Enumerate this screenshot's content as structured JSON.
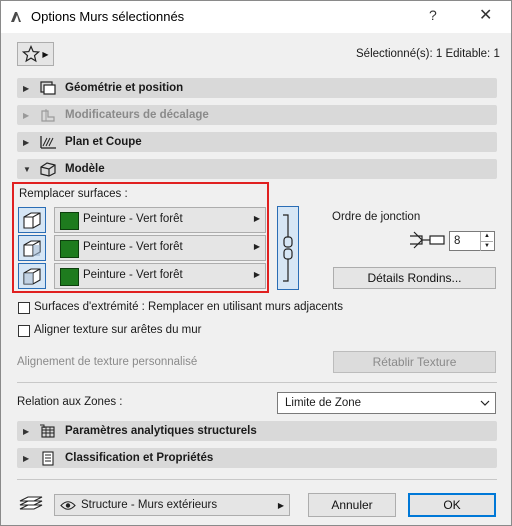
{
  "window": {
    "title": "Options Murs sélectionnés",
    "help": "?",
    "close": "✕"
  },
  "header": {
    "selection_info": "Sélectionné(s): 1 Editable: 1"
  },
  "sections": {
    "geometry": "Géométrie et position",
    "offset": "Modificateurs de décalage",
    "plan": "Plan et Coupe",
    "model": "Modèle",
    "structural": "Paramètres analytiques structurels",
    "classification": "Classification et Propriétés"
  },
  "model": {
    "override_label": "Remplacer surfaces :",
    "surfaces": [
      {
        "material": "Peinture - Vert forêt",
        "color": "#1e7b1e"
      },
      {
        "material": "Peinture - Vert forêt",
        "color": "#1e7b1e"
      },
      {
        "material": "Peinture - Vert forêt",
        "color": "#1e7b1e"
      }
    ],
    "junction_order_label": "Ordre de jonction",
    "junction_order_value": "8",
    "log_details_button": "Détails Rondins...",
    "end_surfaces_label": "Surfaces d'extrémité : Remplacer en utilisant murs adjacents",
    "align_texture_label": "Aligner texture sur arêtes du mur",
    "custom_texture_label": "Alignement de texture personnalisé",
    "reset_texture_button": "Rétablir Texture",
    "zone_relation_label": "Relation aux Zones :",
    "zone_relation_value": "Limite de Zone"
  },
  "footer": {
    "layer_value": "Structure - Murs extérieurs",
    "cancel": "Annuler",
    "ok": "OK"
  }
}
